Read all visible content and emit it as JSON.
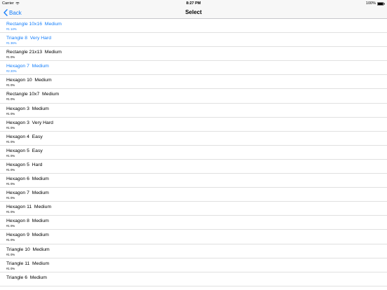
{
  "status_bar": {
    "carrier": "Carrier",
    "time": "8:27 PM",
    "battery": "100%"
  },
  "nav": {
    "back_label": "Back",
    "title": "Select"
  },
  "colors": {
    "accent": "#147efb",
    "text": "#000000",
    "bar": "#f7f7f7",
    "separator": "#e0e0e0"
  },
  "items": [
    {
      "title": "Rectangle 10x16  Medium",
      "subtitle": "#1 14%",
      "highlight": true
    },
    {
      "title": "Triangle 8  Very Hard",
      "subtitle": "#1 36%",
      "highlight": true
    },
    {
      "title": "Rectangle 21x13  Medium",
      "subtitle": "#1 0%",
      "highlight": false
    },
    {
      "title": "Hexagon 7  Medium",
      "subtitle": "#2 20%",
      "highlight": true
    },
    {
      "title": "Hexagon 10  Medium",
      "subtitle": "#1 0%",
      "highlight": false
    },
    {
      "title": "Rectangle 10x7  Medium",
      "subtitle": "#1 0%",
      "highlight": false
    },
    {
      "title": "Hexagon 3  Medium",
      "subtitle": "#1 0%",
      "highlight": false
    },
    {
      "title": "Hexagon 3  Very Hard",
      "subtitle": "#1 0%",
      "highlight": false
    },
    {
      "title": "Hexagon 4  Easy",
      "subtitle": "#1 0%",
      "highlight": false
    },
    {
      "title": "Hexagon 5  Easy",
      "subtitle": "#1 0%",
      "highlight": false
    },
    {
      "title": "Hexagon 5  Hard",
      "subtitle": "#1 0%",
      "highlight": false
    },
    {
      "title": "Hexagon 6  Medium",
      "subtitle": "#1 0%",
      "highlight": false
    },
    {
      "title": "Hexagon 7  Medium",
      "subtitle": "#1 0%",
      "highlight": false
    },
    {
      "title": "Hexagon 11  Medium",
      "subtitle": "#1 0%",
      "highlight": false
    },
    {
      "title": "Hexagon 8  Medium",
      "subtitle": "#1 0%",
      "highlight": false
    },
    {
      "title": "Hexagon 9  Medium",
      "subtitle": "#1 0%",
      "highlight": false
    },
    {
      "title": "Triangle 10  Medium",
      "subtitle": "#1 0%",
      "highlight": false
    },
    {
      "title": "Triangle 11  Medium",
      "subtitle": "#1 0%",
      "highlight": false
    },
    {
      "title": "Triangle 6  Medium",
      "subtitle": "",
      "highlight": false
    }
  ]
}
